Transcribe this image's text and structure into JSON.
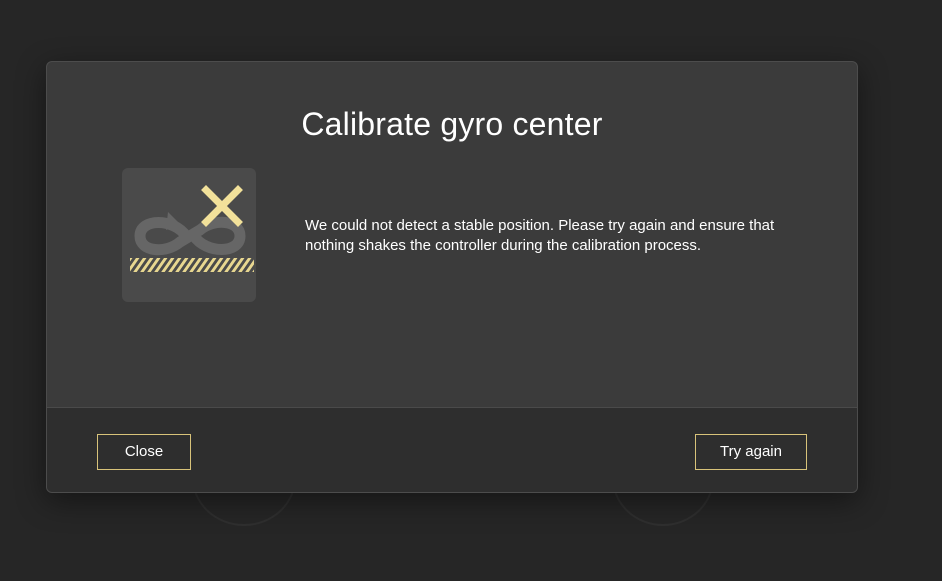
{
  "dialog": {
    "title": "Calibrate gyro center",
    "message": "We could not detect a stable position. Please try again and ensure that nothing shakes the controller during the calibration process.",
    "icon": "gyro-calibration-failed-icon"
  },
  "footer": {
    "close_label": "Close",
    "retry_label": "Try again"
  },
  "colors": {
    "accent": "#d8c37a",
    "dialog_bg": "#3b3b3b",
    "footer_bg": "#2e2e2e",
    "icon_x": "#f2e19a"
  }
}
